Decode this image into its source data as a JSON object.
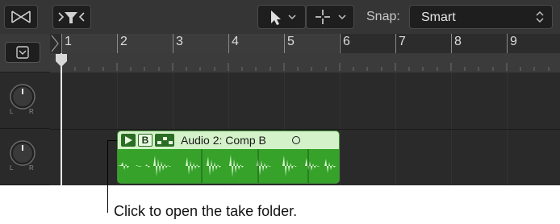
{
  "toolbar": {
    "snap_label": "Snap:",
    "snap_value": "Smart",
    "icons": [
      "crossfade-tool-icon",
      "catch-filter-icon",
      "pointer-tool-icon",
      "crosshair-tool-icon",
      "chevron-down-icon",
      "up-down-arrows-icon"
    ]
  },
  "ruler": {
    "bars": [
      "1",
      "2",
      "3",
      "4",
      "5",
      "6",
      "7",
      "8",
      "9"
    ]
  },
  "tracks": [
    {
      "pan_left": "L",
      "pan_right": "R"
    },
    {
      "pan_left": "L",
      "pan_right": "R"
    }
  ],
  "region": {
    "title": "Audio 2: Comp B",
    "take_letter": "B",
    "color": "#6ac95a"
  },
  "callout": {
    "text": "Click to open the take folder."
  }
}
